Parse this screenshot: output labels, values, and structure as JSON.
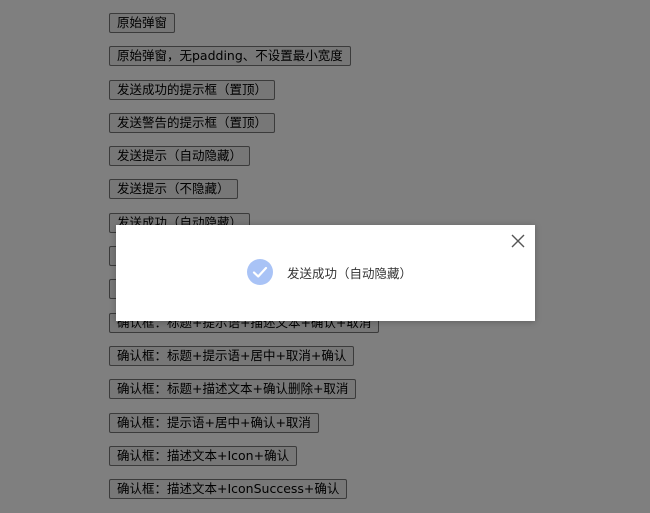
{
  "buttons": [
    {
      "label": "原始弹窗"
    },
    {
      "label": "原始弹窗，无padding、不设置最小宽度"
    },
    {
      "label": "发送成功的提示框（置顶）"
    },
    {
      "label": "发送警告的提示框（置顶）"
    },
    {
      "label": "发送提示（自动隐藏）"
    },
    {
      "label": "发送提示（不隐藏）"
    },
    {
      "label": "发送成功（自动隐藏）"
    },
    {
      "label": ""
    },
    {
      "label": ""
    },
    {
      "label": "确认框：标题+提示语+描述文本+确认+取消"
    },
    {
      "label": "确认框：标题+提示语+居中+取消+确认"
    },
    {
      "label": "确认框：标题+描述文本+确认删除+取消"
    },
    {
      "label": "确认框：提示语+居中+确认+取消"
    },
    {
      "label": "确认框：描述文本+Icon+确认"
    },
    {
      "label": "确认框：描述文本+IconSuccess+确认"
    }
  ],
  "toast": {
    "message": "发送成功（自动隐藏）",
    "icon": "check-circle-icon",
    "icon_color": "#a9c3f6",
    "close_icon": "close-icon"
  },
  "colors": {
    "overlay": "rgba(0,0,0,0.5)",
    "button_bg": "#efefef",
    "button_border": "#767676"
  }
}
